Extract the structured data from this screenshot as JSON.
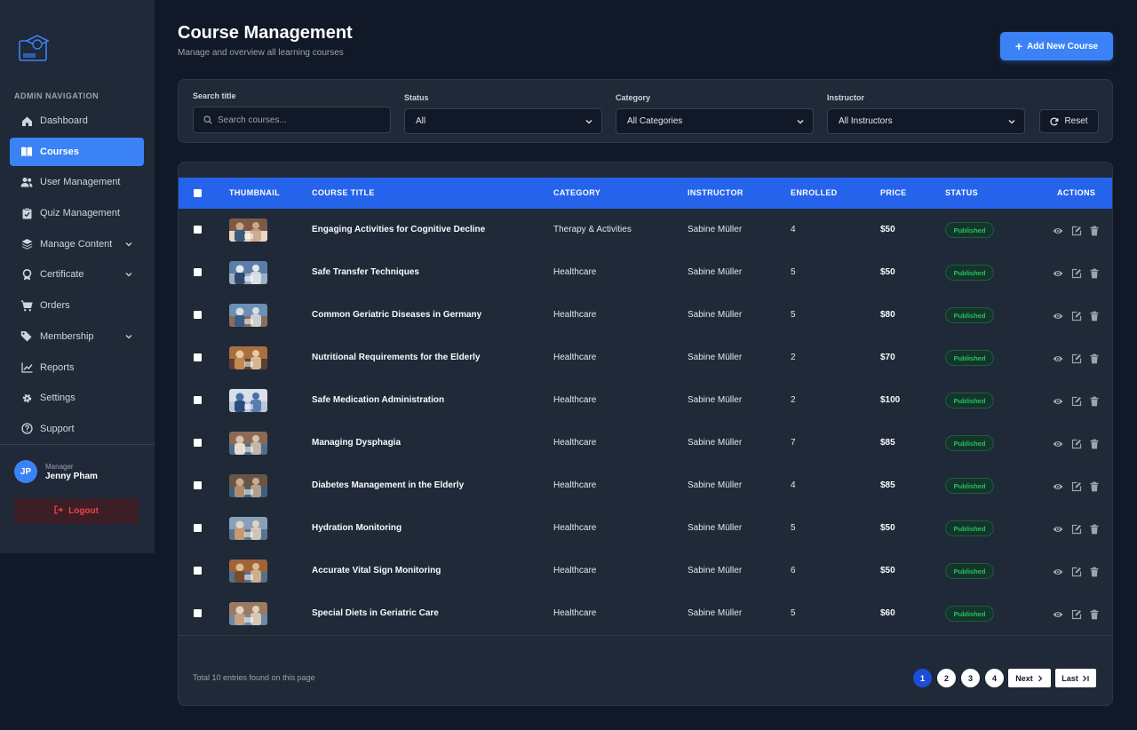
{
  "sidebar": {
    "heading": "ADMIN NAVIGATION",
    "items": [
      {
        "label": "Dashboard",
        "icon": "home-icon",
        "active": false,
        "expandable": false
      },
      {
        "label": "Courses",
        "icon": "book-icon",
        "active": true,
        "expandable": false
      },
      {
        "label": "User Management",
        "icon": "users-icon",
        "active": false,
        "expandable": false
      },
      {
        "label": "Quiz Management",
        "icon": "clipboard-check-icon",
        "active": false,
        "expandable": false
      },
      {
        "label": "Manage Content",
        "icon": "layers-icon",
        "active": false,
        "expandable": true
      },
      {
        "label": "Certificate",
        "icon": "award-icon",
        "active": false,
        "expandable": true
      },
      {
        "label": "Orders",
        "icon": "cart-icon",
        "active": false,
        "expandable": false
      },
      {
        "label": "Membership",
        "icon": "tag-icon",
        "active": false,
        "expandable": true
      },
      {
        "label": "Reports",
        "icon": "chart-line-icon",
        "active": false,
        "expandable": false
      },
      {
        "label": "Settings",
        "icon": "gear-icon",
        "active": false,
        "expandable": false
      },
      {
        "label": "Support",
        "icon": "question-circle-icon",
        "active": false,
        "expandable": false
      }
    ],
    "user": {
      "initials": "JP",
      "role": "Manager",
      "name": "Jenny Pham"
    },
    "logout_label": "Logout"
  },
  "header": {
    "title": "Course Management",
    "subtitle": "Manage and overview all learning courses",
    "add_button": "Add New Course"
  },
  "filters": {
    "search_label": "Search title",
    "search_placeholder": "Search courses...",
    "status_label": "Status",
    "status_value": "All",
    "category_label": "Category",
    "category_value": "All Categories",
    "instructor_label": "Instructor",
    "instructor_value": "All Instructors",
    "reset_label": "Reset"
  },
  "table": {
    "columns": [
      "THUMBNAIL",
      "COURSE TITLE",
      "CATEGORY",
      "INSTRUCTOR",
      "ENROLLED",
      "PRICE",
      "STATUS",
      "ACTIONS"
    ],
    "rows": [
      {
        "title": "Engaging Activities for Cognitive Decline",
        "category": "Therapy & Activities",
        "instructor": "Sabine Müller",
        "enrolled": "4",
        "price": "$50",
        "status": "Published"
      },
      {
        "title": "Safe Transfer Techniques",
        "category": "Healthcare",
        "instructor": "Sabine Müller",
        "enrolled": "5",
        "price": "$50",
        "status": "Published"
      },
      {
        "title": "Common Geriatric Diseases in Germany",
        "category": "Healthcare",
        "instructor": "Sabine Müller",
        "enrolled": "5",
        "price": "$80",
        "status": "Published"
      },
      {
        "title": "Nutritional Requirements for the Elderly",
        "category": "Healthcare",
        "instructor": "Sabine Müller",
        "enrolled": "2",
        "price": "$70",
        "status": "Published"
      },
      {
        "title": "Safe Medication Administration",
        "category": "Healthcare",
        "instructor": "Sabine Müller",
        "enrolled": "2",
        "price": "$100",
        "status": "Published"
      },
      {
        "title": "Managing Dysphagia",
        "category": "Healthcare",
        "instructor": "Sabine Müller",
        "enrolled": "7",
        "price": "$85",
        "status": "Published"
      },
      {
        "title": "Diabetes Management in the Elderly",
        "category": "Healthcare",
        "instructor": "Sabine Müller",
        "enrolled": "4",
        "price": "$85",
        "status": "Published"
      },
      {
        "title": "Hydration Monitoring",
        "category": "Healthcare",
        "instructor": "Sabine Müller",
        "enrolled": "5",
        "price": "$50",
        "status": "Published"
      },
      {
        "title": "Accurate Vital Sign Monitoring",
        "category": "Healthcare",
        "instructor": "Sabine Müller",
        "enrolled": "6",
        "price": "$50",
        "status": "Published"
      },
      {
        "title": "Special Diets in Geriatric Care",
        "category": "Healthcare",
        "instructor": "Sabine Müller",
        "enrolled": "5",
        "price": "$60",
        "status": "Published"
      }
    ],
    "total_text": "Total 10 entries found on this page"
  },
  "pagination": {
    "pages": [
      "1",
      "2",
      "3",
      "4"
    ],
    "current": "1",
    "next_label": "Next",
    "last_label": "Last"
  },
  "colors": {
    "accent": "#3b82f6",
    "header_row": "#2563eb",
    "published": "#22c55e",
    "logout": "#ef4444"
  }
}
